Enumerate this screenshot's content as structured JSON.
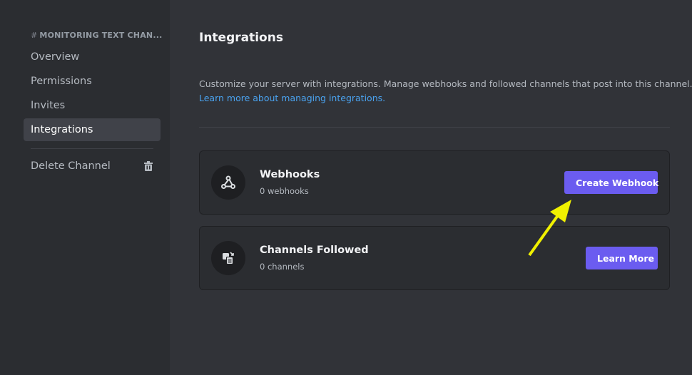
{
  "sidebar": {
    "channel_header": "MONITORING TEXT CHAN...",
    "items": [
      {
        "label": "Overview",
        "active": false
      },
      {
        "label": "Permissions",
        "active": false
      },
      {
        "label": "Invites",
        "active": false
      },
      {
        "label": "Integrations",
        "active": true
      }
    ],
    "delete_label": "Delete Channel",
    "delete_icon": "trash-icon"
  },
  "main": {
    "title": "Integrations",
    "description": "Customize your server with integrations. Manage webhooks and followed channels that post into this channel.",
    "learn_more_link": "Learn more about managing integrations.",
    "cards": [
      {
        "title": "Webhooks",
        "subtitle": "0 webhooks",
        "icon": "webhook-icon",
        "button_label": "Create Webhook"
      },
      {
        "title": "Channels Followed",
        "subtitle": "0 channels",
        "icon": "channel-follow-icon",
        "button_label": "Learn More"
      }
    ]
  },
  "annotation": {
    "type": "arrow",
    "color": "#f0f000",
    "points_to": "Create Webhook"
  },
  "colors": {
    "accent_button": "#6b5cf0",
    "link": "#4aa3f0",
    "sidebar_bg": "#2b2d31",
    "main_bg": "#313338"
  }
}
